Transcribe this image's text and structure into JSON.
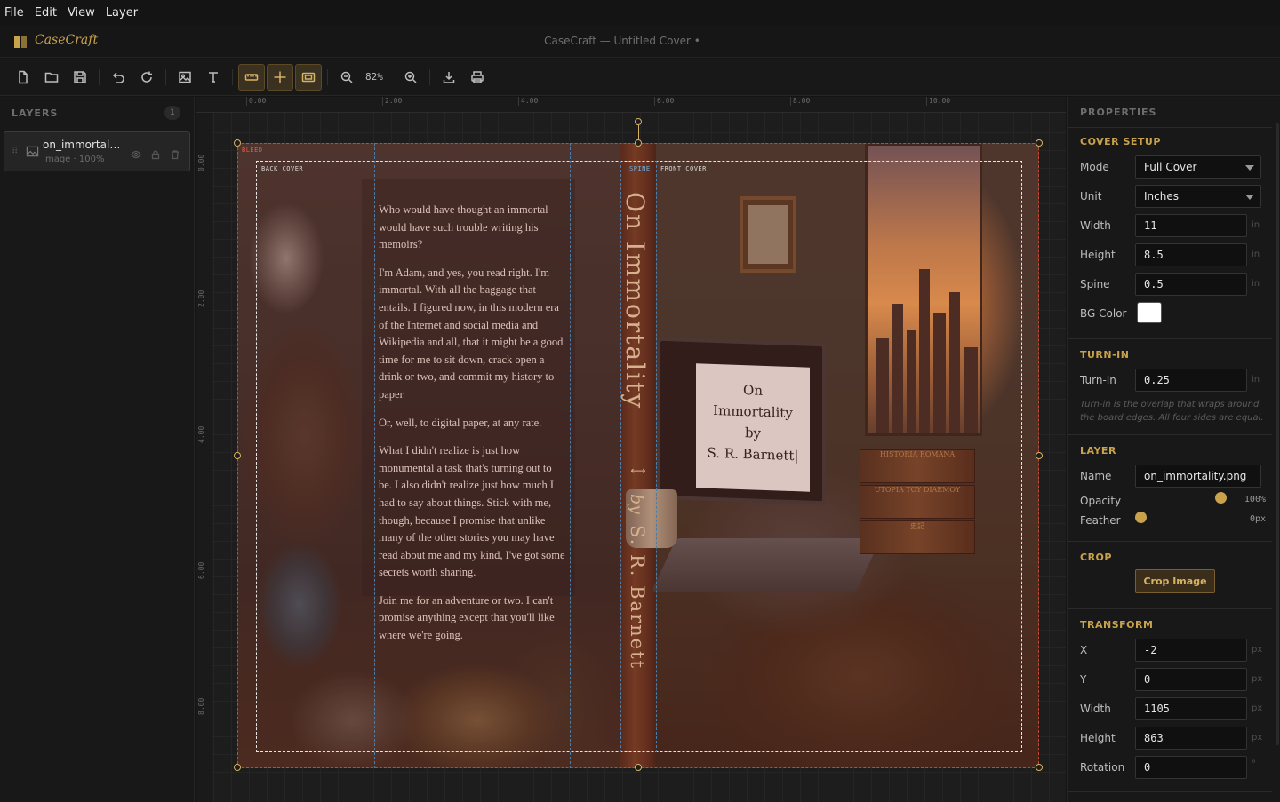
{
  "menu": [
    "File",
    "Edit",
    "View",
    "Layer"
  ],
  "app": {
    "name": "CaseCraft",
    "window_title": "CaseCraft — Untitled Cover •"
  },
  "toolbar": {
    "zoom": "82%"
  },
  "layers": {
    "title": "LAYERS",
    "count": "1",
    "items": [
      {
        "name": "on_immortality.png",
        "display_name": "on_immortali…",
        "meta": "Image · 100%"
      }
    ]
  },
  "rulers": {
    "h": [
      "0.00",
      "2.00",
      "4.00",
      "6.00",
      "8.00",
      "10.00"
    ],
    "v": [
      "0.00",
      "2.00",
      "4.00",
      "6.00",
      "8.00"
    ]
  },
  "guides": {
    "bleed": "BLEED",
    "back_cover": "BACK COVER",
    "spine": "SPINE",
    "front_cover": "FRONT COVER"
  },
  "cover": {
    "back_paragraphs": [
      "Who would have thought an immortal would have such trouble writing his memoirs?",
      "I'm Adam, and yes, you read right. I'm immortal. With all the baggage that entails. I figured now, in this modern era of the Internet and social media and Wikipedia and all, that it might be a good time for me to sit down, crack open a drink or two, and commit my history to paper",
      "Or, well, to digital paper, at any rate.",
      "What I didn't realize is just how monumental a task that's turning out to be. I also didn't realize just how much I had to say about things. Stick with me, though, because I promise that unlike many of the other stories you may have read about me and my kind, I've got some secrets worth sharing.",
      "Join me for an adventure or two. I can't promise anything except that you'll like where we're going."
    ],
    "spine_title": "On Immortality",
    "spine_ornament": "⟷",
    "spine_by": "by",
    "spine_author": "S. R. Barnett",
    "laptop_lines": [
      "On",
      "Immortality",
      "by",
      "S. R. Barnett|"
    ],
    "book_titles": [
      "HISTORIA ROMANA",
      "UTOPIA TOY DIAEMOY",
      "史記"
    ]
  },
  "properties": {
    "title": "PROPERTIES",
    "cover_setup": {
      "title": "COVER SETUP",
      "mode_label": "Mode",
      "mode_value": "Full Cover",
      "unit_label": "Unit",
      "unit_value": "Inches",
      "width_label": "Width",
      "width_value": "11",
      "width_unit": "in",
      "height_label": "Height",
      "height_value": "8.5",
      "height_unit": "in",
      "spine_label": "Spine",
      "spine_value": "0.5",
      "spine_unit": "in",
      "bg_label": "BG Color",
      "bg_color": "#ffffff"
    },
    "turn_in": {
      "title": "TURN-IN",
      "label": "Turn-In",
      "value": "0.25",
      "unit": "in",
      "note": "Turn-in is the overlap that wraps around the board edges. All four sides are equal."
    },
    "layer": {
      "title": "LAYER",
      "name_label": "Name",
      "name_value": "on_immortality.png",
      "opacity_label": "Opacity",
      "opacity_value": "100%",
      "opacity_fraction": 1.0,
      "feather_label": "Feather",
      "feather_value": "0px",
      "feather_fraction": 0.0
    },
    "crop": {
      "title": "CROP",
      "button": "Crop Image"
    },
    "transform": {
      "title": "TRANSFORM",
      "x_label": "X",
      "x_value": "-2",
      "x_unit": "px",
      "y_label": "Y",
      "y_value": "0",
      "y_unit": "px",
      "w_label": "Width",
      "w_value": "1105",
      "w_unit": "px",
      "h_label": "Height",
      "h_value": "863",
      "h_unit": "px",
      "r_label": "Rotation",
      "r_value": "0",
      "r_unit": "°"
    }
  },
  "colors": {
    "accent": "#c9a24c",
    "bleed": "#c14a3a",
    "spine_guide": "#4a7ea8"
  }
}
